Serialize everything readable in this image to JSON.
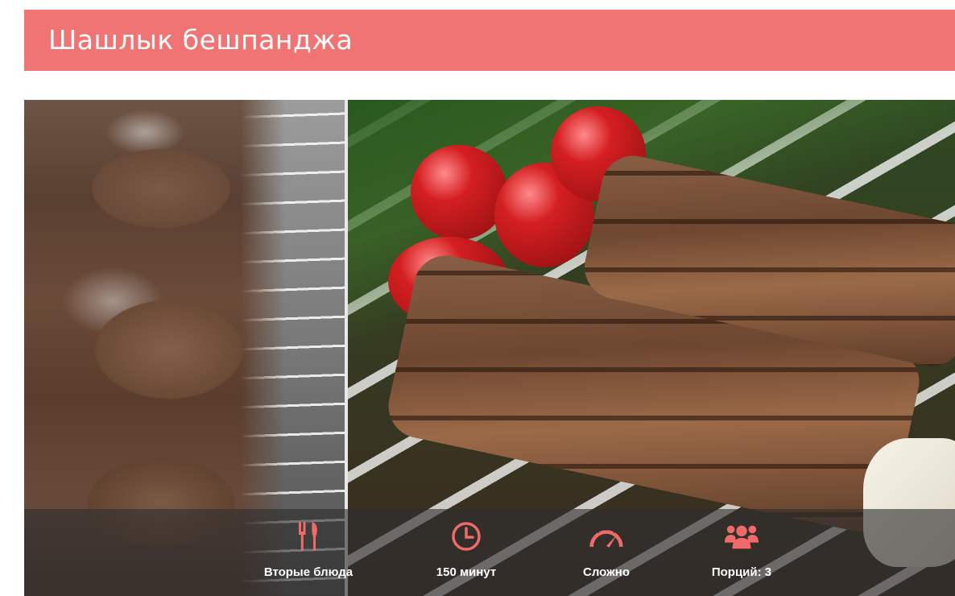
{
  "recipe": {
    "title": "Шашлык бешпанджа"
  },
  "info": {
    "category": "Вторые блюда",
    "time": "150 минут",
    "difficulty": "Сложно",
    "servings": "Порций: 3"
  },
  "colors": {
    "accent": "#f07474",
    "icon": "#f06a6a"
  },
  "icons": {
    "category": "fork-knife-icon",
    "time": "clock-icon",
    "difficulty": "gauge-icon",
    "servings": "people-icon"
  }
}
